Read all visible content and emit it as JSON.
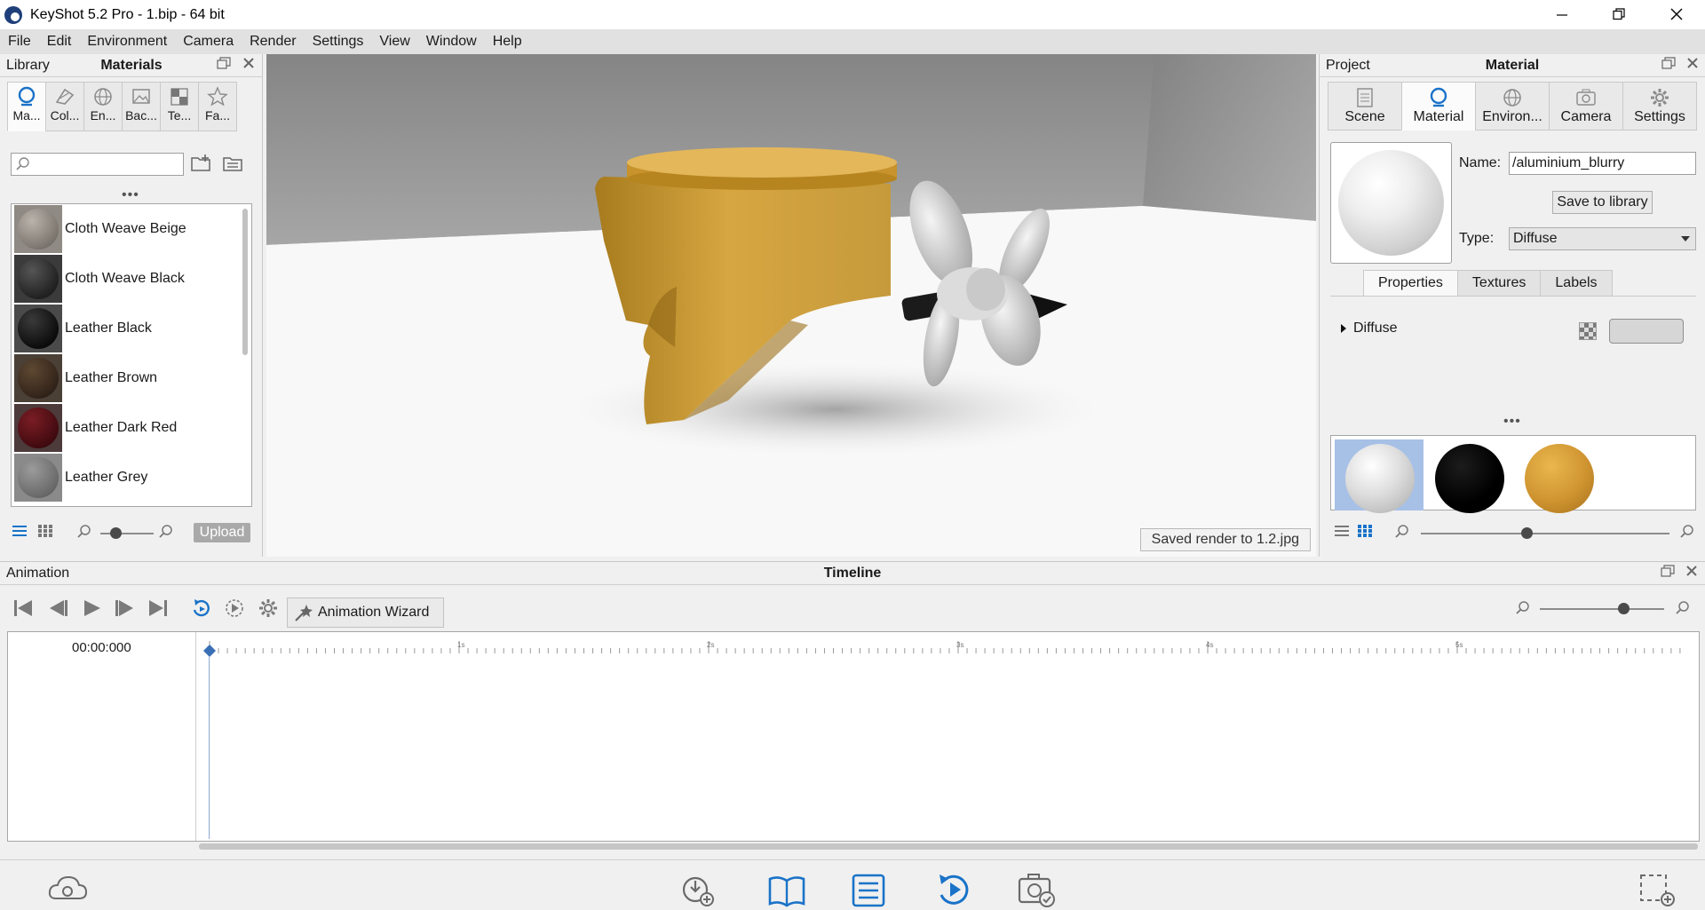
{
  "window": {
    "title": "KeyShot 5.2 Pro  - 1.bip  - 64 bit",
    "controls": [
      "minimize",
      "restore",
      "close"
    ]
  },
  "menu": [
    "File",
    "Edit",
    "Environment",
    "Camera",
    "Render",
    "Settings",
    "View",
    "Window",
    "Help"
  ],
  "library": {
    "left_title": "Library",
    "center_title": "Materials",
    "tabs": [
      {
        "label": "Ma...",
        "icon": "material-sphere-icon"
      },
      {
        "label": "Col...",
        "icon": "color-palette-icon"
      },
      {
        "label": "En...",
        "icon": "environment-globe-icon"
      },
      {
        "label": "Bac...",
        "icon": "backplate-image-icon"
      },
      {
        "label": "Te...",
        "icon": "texture-checker-icon"
      },
      {
        "label": "Fa...",
        "icon": "favorites-star-icon"
      }
    ],
    "search_placeholder": "",
    "more": "•••",
    "items": [
      {
        "label": "Cloth Weave Beige",
        "color": "#8c8780"
      },
      {
        "label": "Cloth Weave Black",
        "color": "#2a2a2a"
      },
      {
        "label": "Leather Black",
        "color": "#151515"
      },
      {
        "label": "Leather Brown",
        "color": "#3b2a1a"
      },
      {
        "label": "Leather Dark Red",
        "color": "#4a0e12"
      },
      {
        "label": "Leather Grey",
        "color": "#6d6d6d"
      }
    ],
    "upload_label": "Upload"
  },
  "viewport": {
    "status": "Saved render to 1.2.jpg"
  },
  "material_panel": {
    "left_title": "Project",
    "center_title": "Material",
    "tabs": [
      {
        "label": "Scene",
        "icon": "scene-list-icon"
      },
      {
        "label": "Material",
        "icon": "material-sphere-icon"
      },
      {
        "label": "Environ...",
        "icon": "environment-globe-icon"
      },
      {
        "label": "Camera",
        "icon": "camera-icon"
      },
      {
        "label": "Settings",
        "icon": "gear-icon"
      }
    ],
    "name_label": "Name:",
    "name_value": "/aluminium_blurry",
    "save_to_library": "Save to library",
    "type_label": "Type:",
    "type_value": "Diffuse",
    "prop_tabs": [
      "Properties",
      "Textures",
      "Labels"
    ],
    "diffuse_label": "Diffuse",
    "diffuse_color": "#d6d6d6",
    "more": "•••",
    "thumbnails": [
      {
        "name": "aluminium",
        "color": "#d9d9d9"
      },
      {
        "name": "black",
        "color": "#000000"
      },
      {
        "name": "wood",
        "color": "#d49a32"
      }
    ]
  },
  "animation": {
    "left_title": "Animation",
    "center_title": "Timeline",
    "wizard_label": "Animation Wizard",
    "time": "00:00:000",
    "ruler_labels": [
      "1s",
      "2s",
      "3s",
      "4s",
      "5s"
    ]
  },
  "colors": {
    "accent_blue": "#1a73c8",
    "menu_bg": "#e1e1e1",
    "panel_bg": "#f0f0f0",
    "selection": "#a7c0e6"
  }
}
